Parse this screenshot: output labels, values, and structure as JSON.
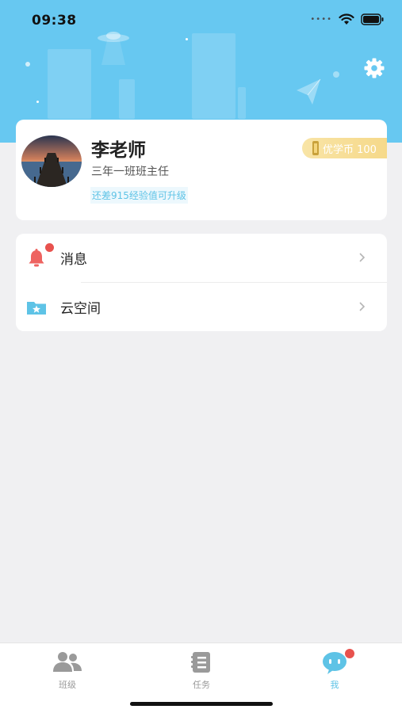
{
  "status_bar": {
    "time": "09:38"
  },
  "profile": {
    "name": "李老师",
    "role": "三年一班班主任",
    "upgrade_hint": "还差915经验值可升级",
    "coins_label": "优学币 100"
  },
  "menu": {
    "items": [
      {
        "label": "消息",
        "icon": "bell-icon",
        "has_badge": true
      },
      {
        "label": "云空间",
        "icon": "folder-star-icon",
        "has_badge": false
      }
    ]
  },
  "tabbar": {
    "tabs": [
      {
        "label": "班级",
        "icon": "people-icon",
        "active": false
      },
      {
        "label": "任务",
        "icon": "notebook-icon",
        "active": false
      },
      {
        "label": "我",
        "icon": "chat-face-icon",
        "active": true,
        "has_badge": true
      }
    ]
  },
  "colors": {
    "header_bg": "#67c8f1",
    "accent": "#5ec3e6",
    "badge_red": "#e8524e",
    "coin_gold": "#f6d98a"
  }
}
